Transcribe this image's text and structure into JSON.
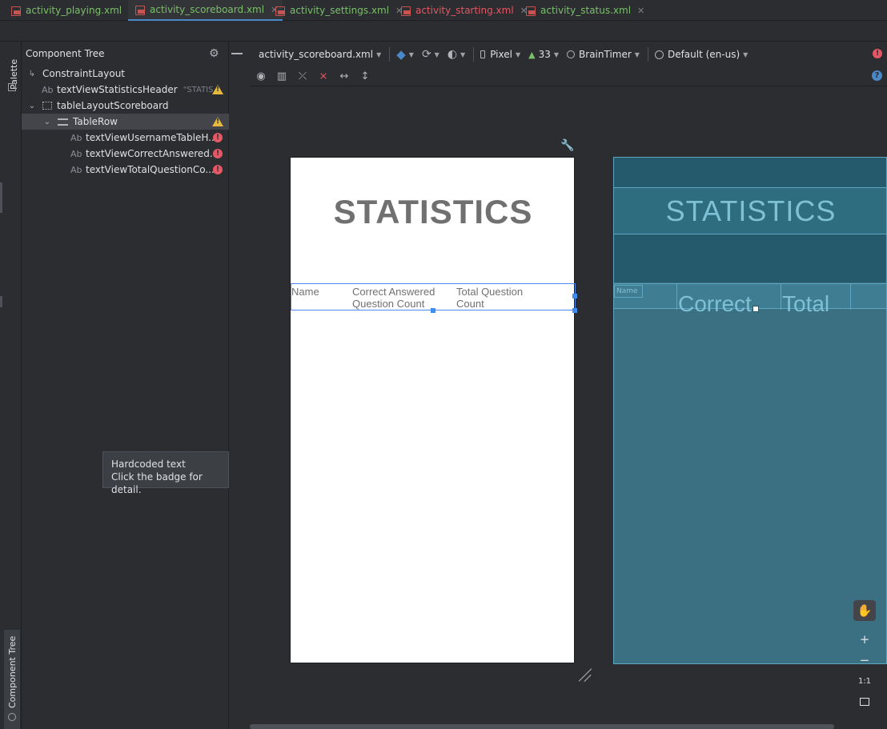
{
  "tabs": [
    {
      "label": "activity_playing.xml",
      "color": "#7bbf6a",
      "active": false
    },
    {
      "label": "activity_scoreboard.xml",
      "color": "#7bbf6a",
      "active": true
    },
    {
      "label": "activity_settings.xml",
      "color": "#7bbf6a",
      "active": false
    },
    {
      "label": "activity_starting.xml",
      "color": "#e55765",
      "active": false
    },
    {
      "label": "activity_status.xml",
      "color": "#7bbf6a",
      "active": false
    }
  ],
  "left_strip": {
    "palette_label": "Palette",
    "component_tree_label": "Component Tree"
  },
  "tree": {
    "title": "Component Tree",
    "nodes": [
      {
        "label": "ConstraintLayout",
        "type": "layout"
      },
      {
        "label": "textViewStatisticsHeader",
        "hint": "\"STATIS...",
        "type": "text",
        "badge": "warning"
      },
      {
        "label": "tableLayoutScoreboard",
        "type": "table"
      },
      {
        "label": "TableRow",
        "type": "row",
        "badge": "warning"
      },
      {
        "label": "textViewUsernameTableH...",
        "type": "text",
        "badge": "error"
      },
      {
        "label": "textViewCorrectAnswered...",
        "type": "text",
        "badge": "error"
      },
      {
        "label": "textViewTotalQuestionCo...",
        "type": "text",
        "badge": "error"
      }
    ],
    "ab": "Ab"
  },
  "tooltip": {
    "line1": "Hardcoded text",
    "line2": "Click the badge for detail."
  },
  "toolbar": {
    "file": "activity_scoreboard.xml",
    "device": "Pixel",
    "api": "33",
    "theme": "BrainTimer",
    "locale": "Default (en-us)"
  },
  "design": {
    "title": "STATISTICS",
    "col1": "Name",
    "col2": "Correct Answered Question Count",
    "col3": "Total Question Count"
  },
  "blueprint": {
    "title": "STATISTICS",
    "small_label": "Name",
    "big1": "Correct",
    "big2": "Total"
  },
  "zoom": {
    "one_to_one": "1:1"
  }
}
